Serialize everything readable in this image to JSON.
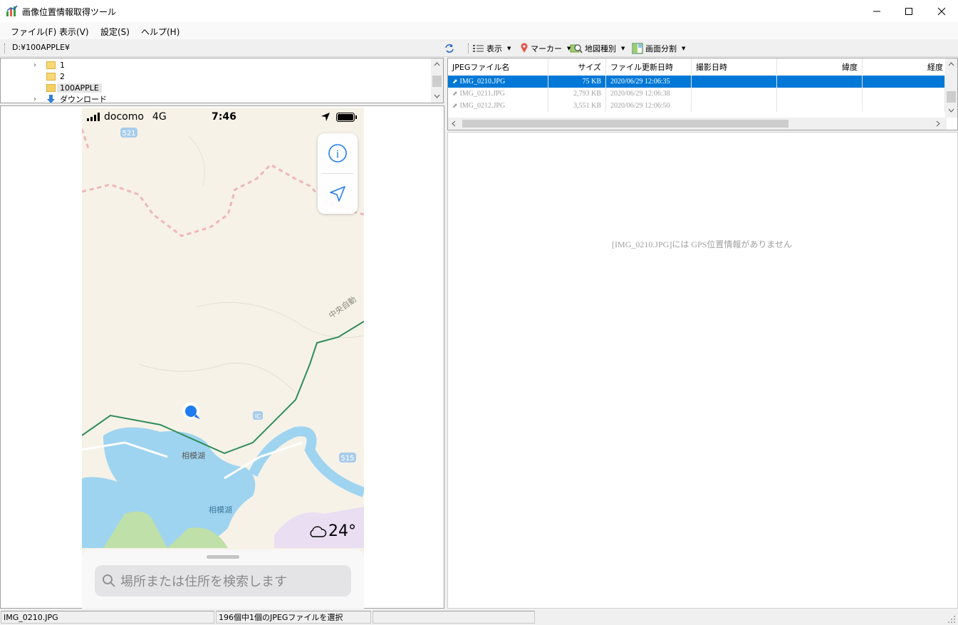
{
  "window": {
    "title": "画像位置情報取得ツール"
  },
  "menu": [
    {
      "label": "ファイル(F)"
    },
    {
      "label": "表示(V)"
    },
    {
      "label": "設定(S)"
    },
    {
      "label": "ヘルプ(H)"
    }
  ],
  "toolbar": {
    "path": "D:¥100APPLE¥",
    "view_label": "表示",
    "marker_label": "マーカー",
    "maptype_label": "地図種別",
    "split_label": "画面分割"
  },
  "tree": {
    "items": [
      {
        "label": "1"
      },
      {
        "label": "2"
      },
      {
        "label": "100APPLE"
      },
      {
        "label": "ダウンロード"
      }
    ]
  },
  "phone": {
    "carrier": "docomo",
    "network": "4G",
    "time": "7:46",
    "road_label": "中央自動",
    "lake_label_1": "相模湖",
    "lake_label_2": "相模湖",
    "route_521": "521",
    "route_515": "515",
    "ic": "IC",
    "weather": "24°",
    "search_placeholder": "場所または住所を検索します",
    "info_glyph": "i"
  },
  "file_list": {
    "columns": [
      "JPEGファイル名",
      "サイズ",
      "ファイル更新日時",
      "撮影日時",
      "緯度",
      "経度"
    ],
    "rows": [
      {
        "name": "IMG_0210.JPG",
        "size": "75 KB",
        "modified": "2020/06/29 12:06:35",
        "taken": "",
        "lat": "",
        "lon": ""
      },
      {
        "name": "IMG_0211.JPG",
        "size": "2,793 KB",
        "modified": "2020/06/29 12:06:38",
        "taken": "",
        "lat": "",
        "lon": ""
      },
      {
        "name": "IMG_0212.JPG",
        "size": "3,551 KB",
        "modified": "2020/06/29 12:06:50",
        "taken": "",
        "lat": "",
        "lon": ""
      }
    ]
  },
  "info": {
    "message": "[IMG_0210.JPG]には GPS位置情報がありません"
  },
  "statusbar": {
    "file": "IMG_0210.JPG",
    "selection": "196個中1個のJPEGファイルを選択"
  },
  "colors": {
    "selection": "#0078d7",
    "water": "#9fd4f0",
    "highway": "#2f8c5a"
  }
}
